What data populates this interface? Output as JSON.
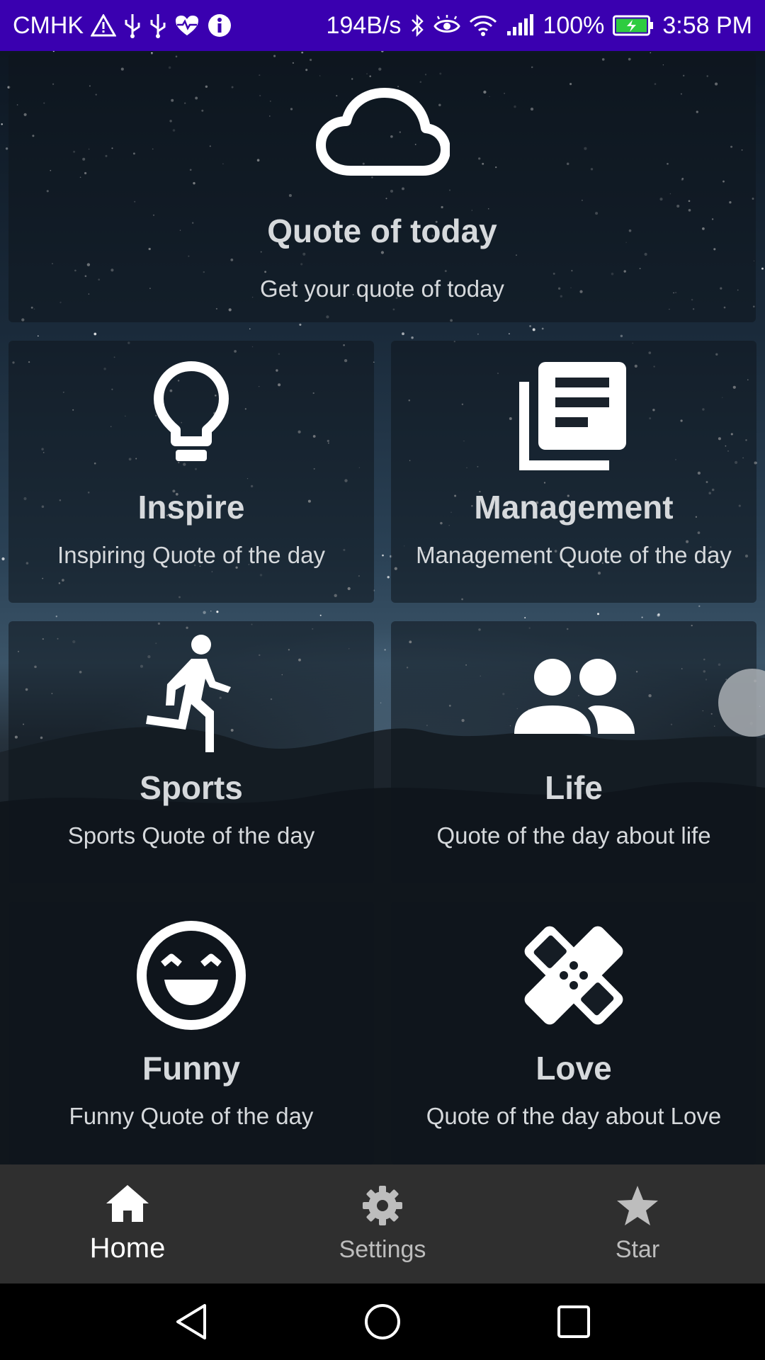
{
  "status_bar": {
    "carrier": "CMHK",
    "speed": "194B/s",
    "battery": "100%",
    "time": "3:58 PM",
    "icons": [
      "warning-icon",
      "usb-icon",
      "usb-icon",
      "heart-monitor-icon",
      "info-icon",
      "bluetooth-icon",
      "eye-icon",
      "wifi-icon",
      "signal-icon",
      "battery-icon"
    ]
  },
  "cards": {
    "today": {
      "title": "Quote of today",
      "subtitle": "Get your quote of today",
      "icon": "cloud-icon"
    },
    "inspire": {
      "title": "Inspire",
      "subtitle": "Inspiring Quote of the day",
      "icon": "lightbulb-icon"
    },
    "management": {
      "title": "Management",
      "subtitle": "Management Quote of the day",
      "icon": "newspaper-icon"
    },
    "sports": {
      "title": "Sports",
      "subtitle": "Sports Quote of the day",
      "icon": "running-icon"
    },
    "life": {
      "title": "Life",
      "subtitle": "Quote of the day about life",
      "icon": "people-icon"
    },
    "funny": {
      "title": "Funny",
      "subtitle": "Funny Quote of the day",
      "icon": "smile-icon"
    },
    "love": {
      "title": "Love",
      "subtitle": "Quote of the day about Love",
      "icon": "bandage-icon"
    }
  },
  "bottom_nav": {
    "items": [
      {
        "label": "Home",
        "icon": "home-icon",
        "active": true
      },
      {
        "label": "Settings",
        "icon": "gear-icon",
        "active": false
      },
      {
        "label": "Star",
        "icon": "star-icon",
        "active": false
      }
    ]
  },
  "colors": {
    "status_bar": "#3a00b0",
    "card_text": "#d6d9dc",
    "bottom_nav": "#2f2f2f",
    "nav_active": "#ffffff",
    "nav_inactive": "#bdbdbd"
  }
}
